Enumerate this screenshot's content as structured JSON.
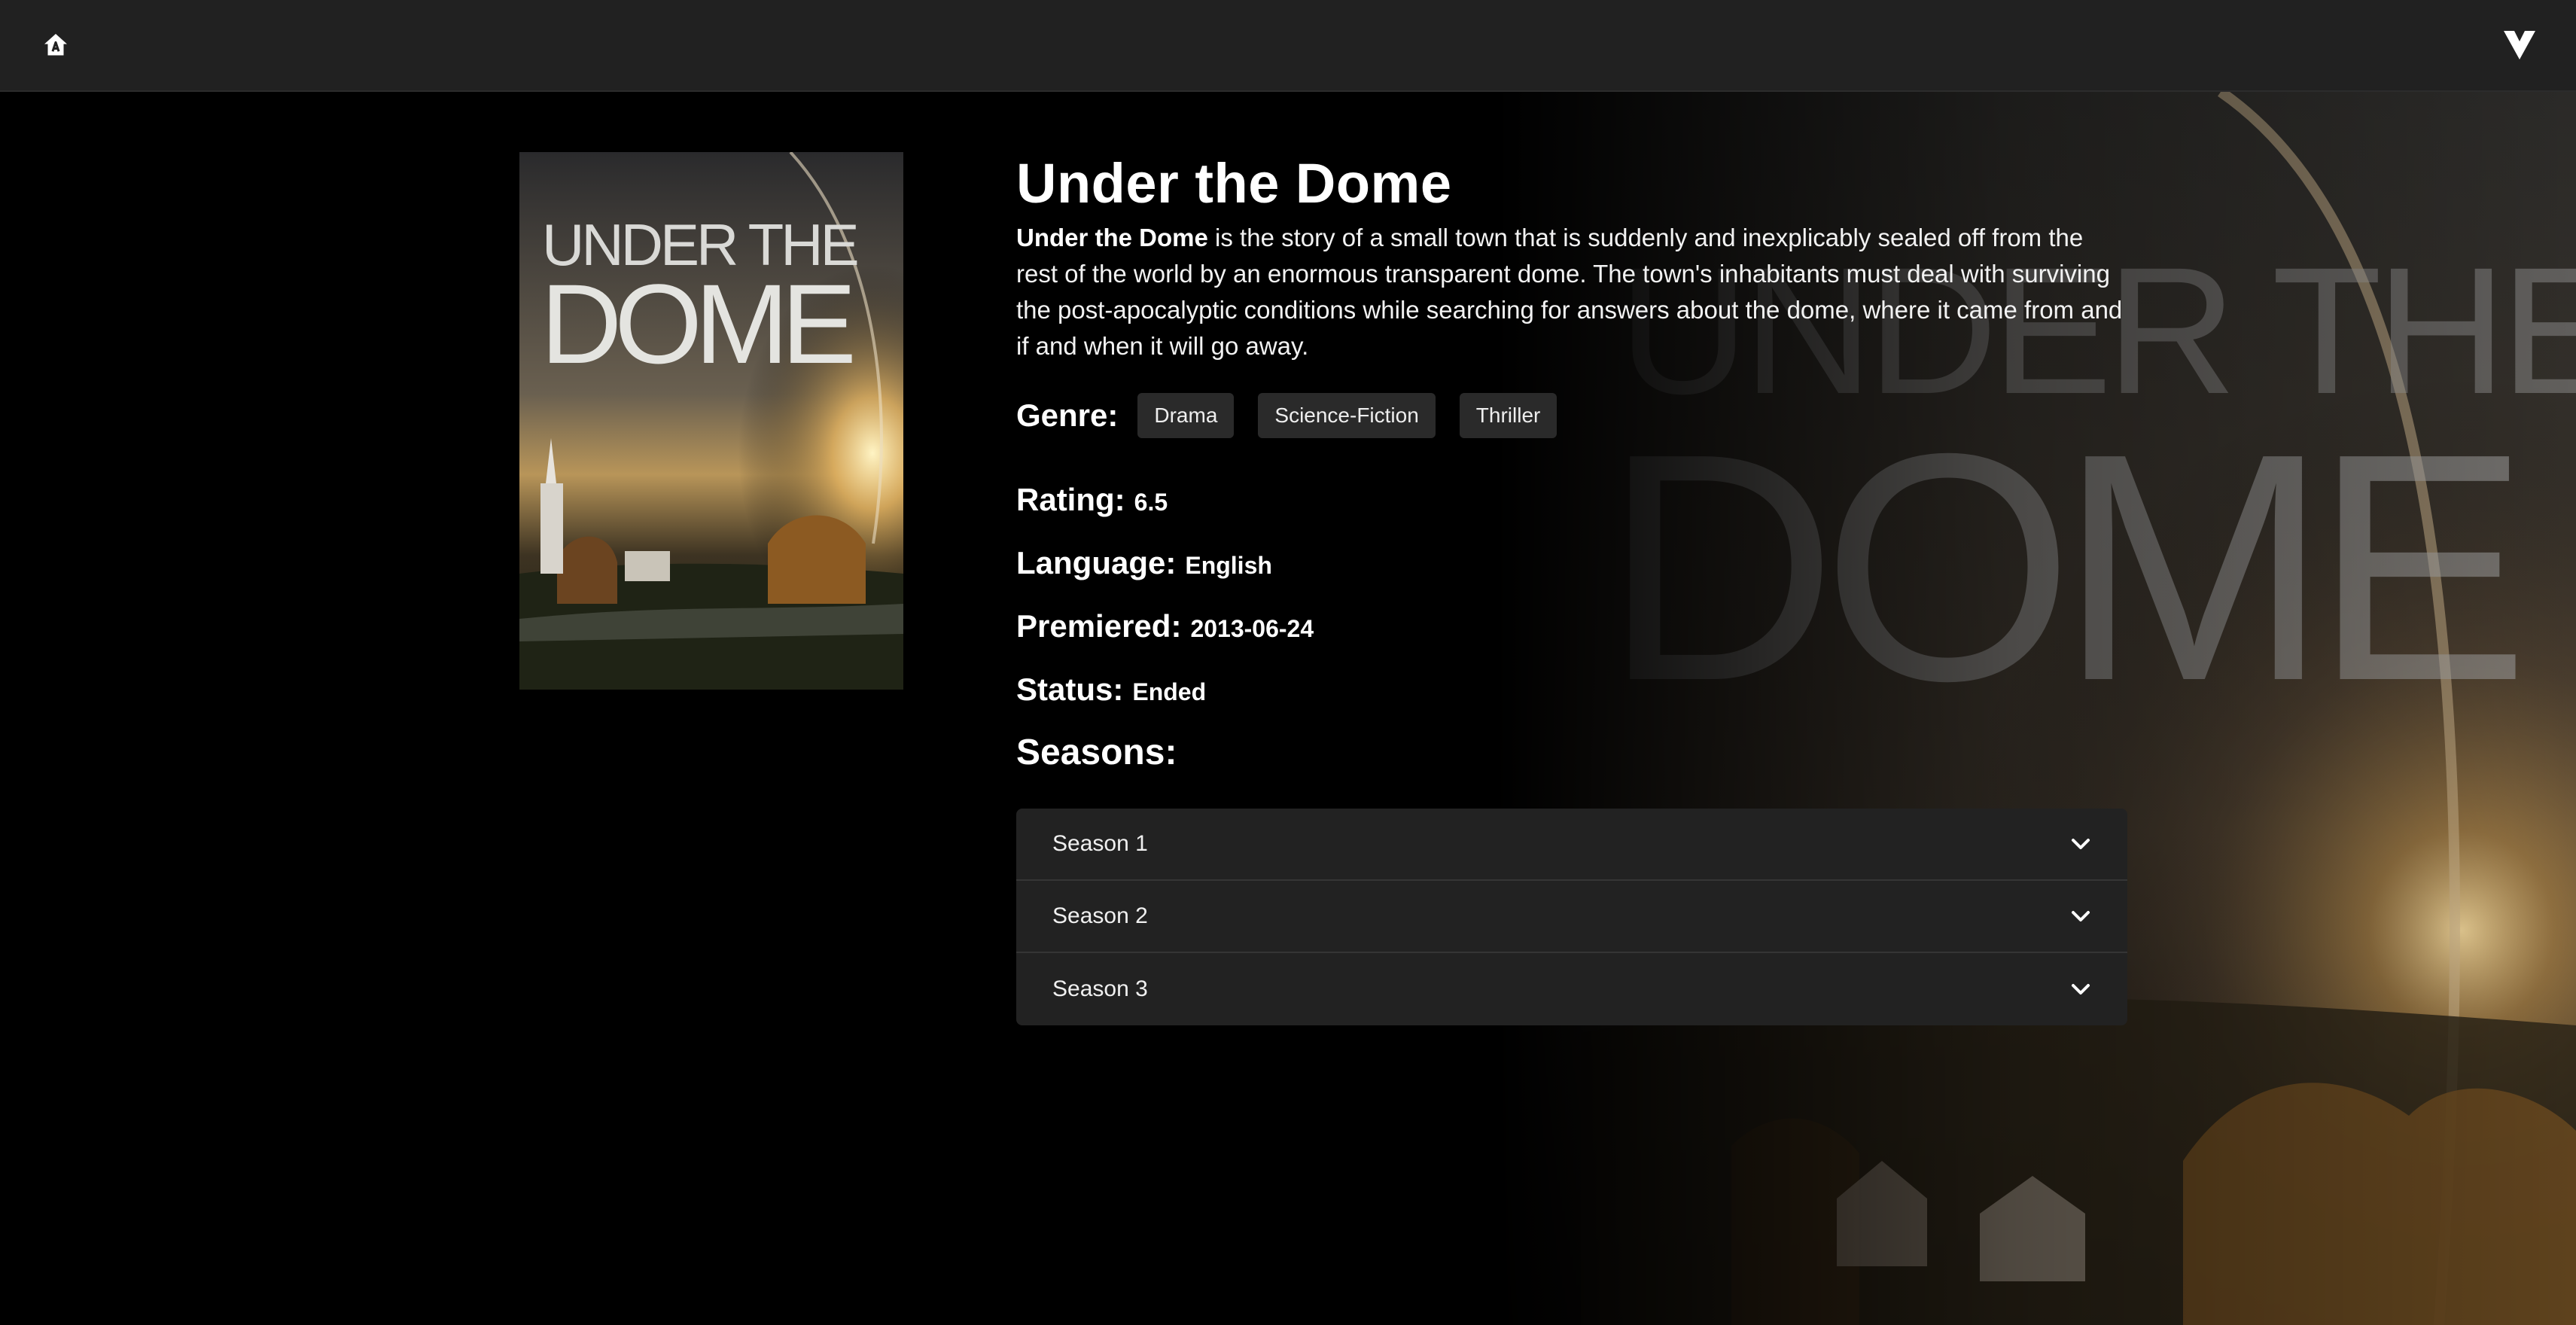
{
  "nav": {
    "home_icon": "home-icon",
    "brand_icon": "brand-logo-icon"
  },
  "show": {
    "title": "Under the Dome",
    "summary_bold": "Under the Dome",
    "summary_rest": " is the story of a small town that is suddenly and inexplicably sealed off from the rest of the world by an enormous transparent dome. The town's inhabitants must deal with surviving the post-apocalyptic conditions while searching for answers about the dome, where it came from and if and when it will go away.",
    "poster_text_line1": "UNDER THE",
    "poster_text_line2": "DOME",
    "genre_label": "Genre:",
    "genres": [
      "Drama",
      "Science-Fiction",
      "Thriller"
    ],
    "rating_label": "Rating:",
    "rating": "6.5",
    "language_label": "Language:",
    "language": "English",
    "premiered_label": "Premiered:",
    "premiered": "2013-06-24",
    "status_label": "Status:",
    "status": "Ended",
    "seasons_label": "Seasons:",
    "seasons": [
      "Season 1",
      "Season 2",
      "Season 3"
    ]
  },
  "colors": {
    "topbar_bg": "#212121",
    "page_bg": "#000000",
    "tag_bg": "#2a2a2a",
    "accordion_bg": "#222222"
  }
}
